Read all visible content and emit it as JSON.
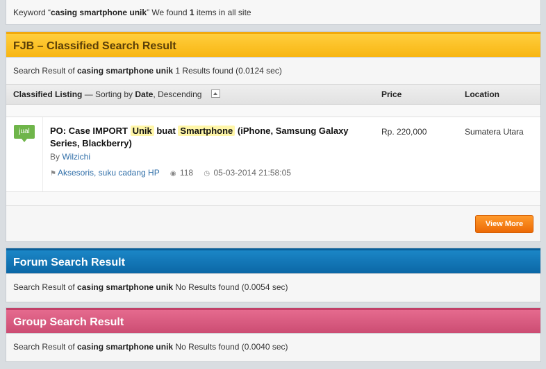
{
  "keyword_bar": {
    "prefix": "Keyword “",
    "keyword": "casing smartphone unik",
    "middle": "” We found ",
    "count": "1",
    "suffix": " items in all site"
  },
  "fjb": {
    "title": "FJB – Classified Search Result",
    "summary": {
      "prefix": "Search Result of ",
      "keyword": "casing smartphone unik",
      "result": " 1 Results found (0.0124 sec)"
    },
    "columns": {
      "listing": "Classified Listing",
      "sort_prefix": " — Sorting by ",
      "sort_field": "Date",
      "sort_dir": ", Descending",
      "price": "Price",
      "location": "Location"
    },
    "item": {
      "tag": "jual",
      "title_part1": "PO: Case IMPORT ",
      "title_hl1": "Unik",
      "title_part2": " buat ",
      "title_hl2": "Smartphone",
      "title_part3": " (iPhone, Samsung Galaxy Series, Blackberry)",
      "by_label": "By ",
      "author": "Wilzichi",
      "category": "Aksesoris, suku cadang HP",
      "views": "118",
      "date": "05-03-2014 21:58:05",
      "price": "Rp. 220,000",
      "location": "Sumatera Utara"
    },
    "view_more_label": "View More"
  },
  "forum": {
    "title": "Forum Search Result",
    "summary": {
      "prefix": "Search Result of ",
      "keyword": "casing smartphone unik",
      "result": " No Results found (0.0054 sec)"
    }
  },
  "group": {
    "title": "Group Search Result",
    "summary": {
      "prefix": "Search Result of ",
      "keyword": "casing smartphone unik",
      "result": " No Results found (0.0040 sec)"
    }
  },
  "colors": {
    "fjb_header": "#f8b613",
    "forum_header": "#0b67a6",
    "group_header": "#cc4d73",
    "tag_green": "#6fb54a",
    "view_more": "#ec6a06",
    "highlight": "#fff6a8"
  },
  "icons": {
    "category": "tag-icon",
    "views": "eye-icon",
    "date": "clock-icon",
    "sort": "sort-ascending-icon"
  }
}
